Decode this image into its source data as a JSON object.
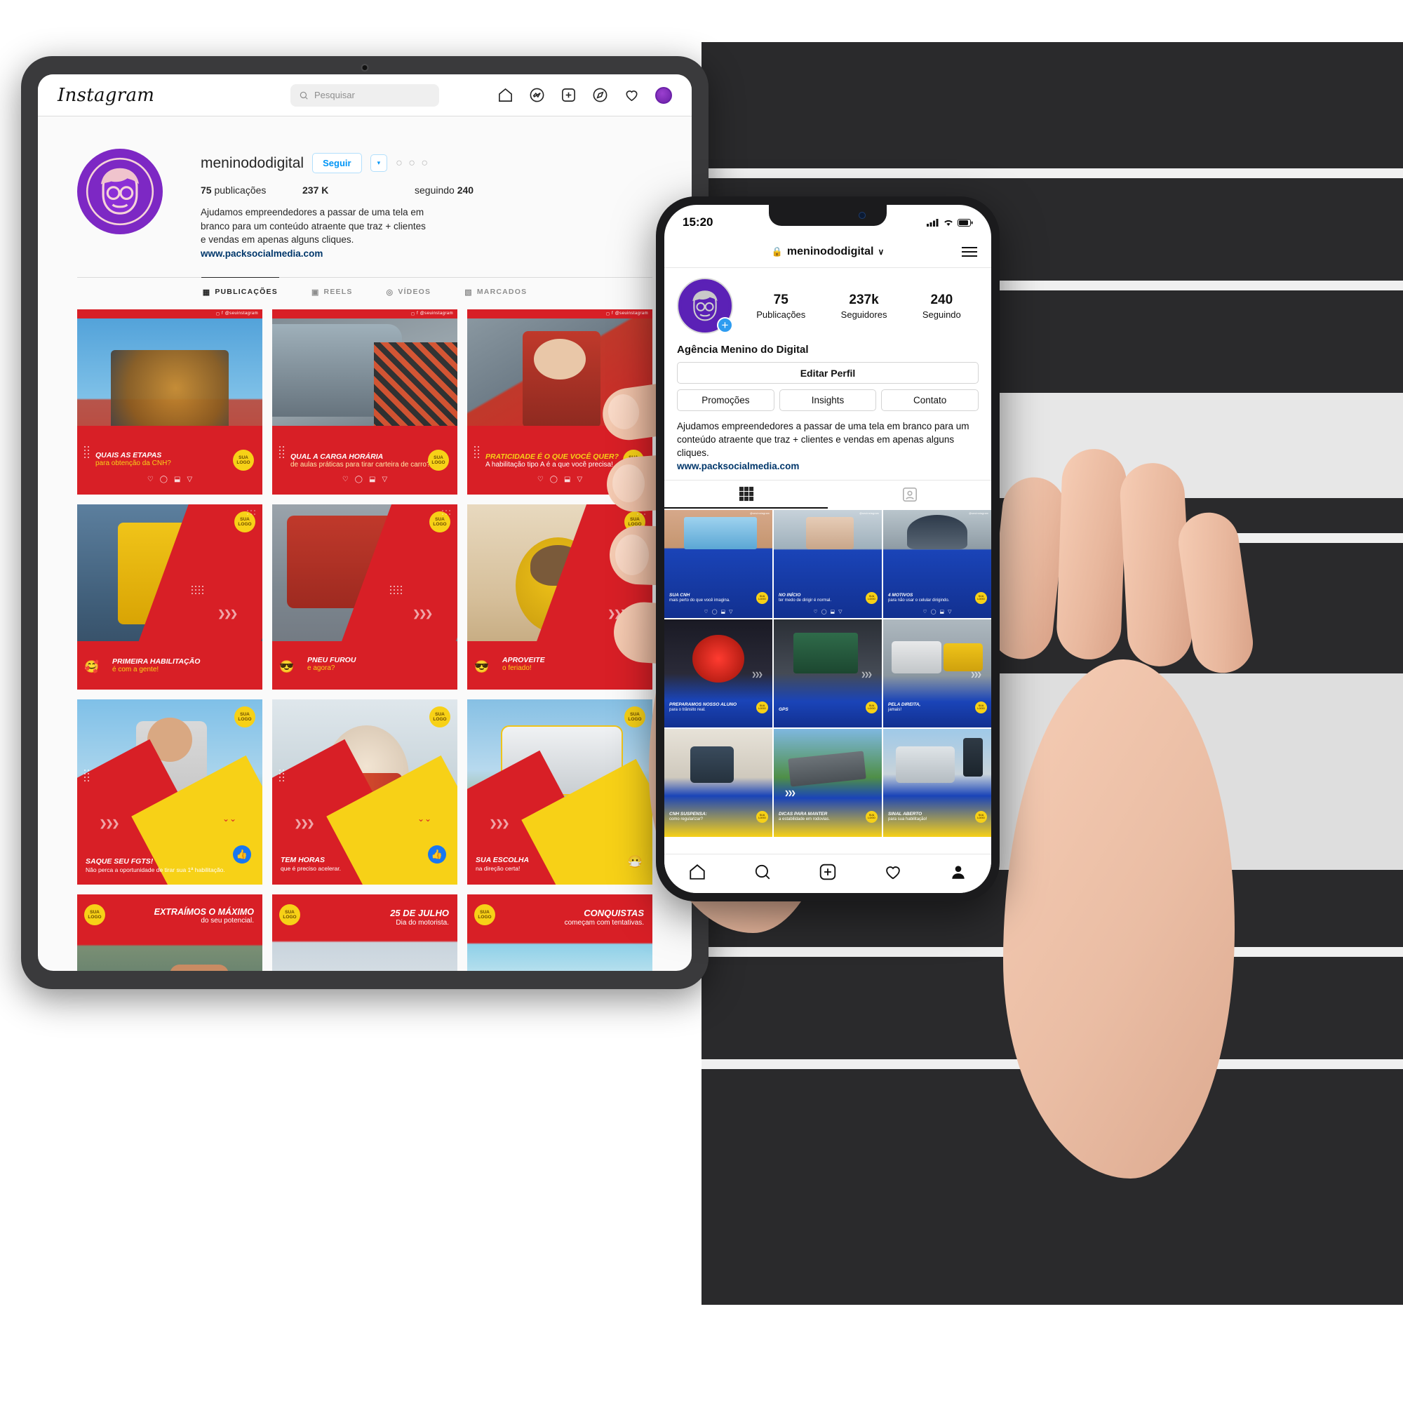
{
  "tablet": {
    "header": {
      "logo": "Instagram",
      "search_placeholder": "Pesquisar",
      "nav_icons": [
        "home-icon",
        "messenger-icon",
        "new-post-icon",
        "explore-icon",
        "activity-icon",
        "profile-avatar-icon"
      ]
    },
    "profile": {
      "username": "meninododigital",
      "follow_label": "Seguir",
      "caret_label": "▾",
      "more_label": "○ ○ ○",
      "stats": {
        "posts_value": "75",
        "posts_label": "publicações",
        "followers_value": "237 K",
        "following_label": "seguindo",
        "following_value": "240"
      },
      "bio": "Ajudamos empreendedores a passar de uma tela em branco para um conteúdo atraente que traz + clientes e vendas em apenas alguns cliques.",
      "link": "www.packsocialmedia.com"
    },
    "tabs": [
      {
        "label": "PUBLICAÇÕES",
        "icon": "grid-icon",
        "active": true
      },
      {
        "label": "REELS",
        "icon": "reels-icon",
        "active": false
      },
      {
        "label": "VÍDEOS",
        "icon": "video-icon",
        "active": false
      },
      {
        "label": "MARCADOS",
        "icon": "tagged-icon",
        "active": false
      }
    ],
    "watermark": "@seuinstagram",
    "sua_logo_line1": "SUA",
    "sua_logo_line2": "LOGO",
    "posts": [
      {
        "title": "QUAIS AS ETAPAS",
        "sub": "para obtenção da CNH?",
        "theme": "red",
        "layout": "bar-bottom"
      },
      {
        "title": "QUAL A CARGA HORÁRIA",
        "sub": "de aulas práticas para tirar carteira de carro?",
        "theme": "red",
        "layout": "bar-bottom"
      },
      {
        "title": "PRATICIDADE É O QUE VOCÊ QUER?",
        "sub": "A habilitação tipo A é a que você precisa!",
        "theme": "red",
        "layout": "bar-bottom"
      },
      {
        "title": "PRIMEIRA HABILITAÇÃO",
        "sub": "é com a gente!",
        "theme": "red-diag",
        "layout": "emoji",
        "emoji": "🥰"
      },
      {
        "title": "PNEU FUROU",
        "sub": "e agora?",
        "theme": "red-diag",
        "layout": "emoji",
        "emoji": "😎"
      },
      {
        "title": "APROVEITE",
        "sub": "o feriado!",
        "theme": "red-diag",
        "layout": "emoji",
        "emoji": "😎"
      },
      {
        "title": "SAQUE SEU FGTS!",
        "sub": "Não perca a oportunidade de tirar sua 1ª habilitação.",
        "theme": "yellow-red",
        "layout": "thumb"
      },
      {
        "title": "TEM HORAS",
        "sub": "que é preciso acelerar.",
        "theme": "yellow-red",
        "layout": "thumb"
      },
      {
        "title": "SUA ESCOLHA",
        "sub": "na direção certa!",
        "theme": "yellow-red",
        "layout": "thumb-emoji",
        "emoji": "😷"
      },
      {
        "title": "EXTRAÍMOS O MÁXIMO",
        "sub": "do seu potencial.",
        "theme": "red-top",
        "layout": "bar-top"
      },
      {
        "title": "25 DE JULHO",
        "sub": "Dia do motorista.",
        "theme": "red-top",
        "layout": "bar-top"
      },
      {
        "title": "CONQUISTAS",
        "sub": "começam com tentativas.",
        "theme": "red-top",
        "layout": "bar-top"
      }
    ]
  },
  "phone": {
    "status": {
      "time": "15:20",
      "signal_icon": "cellular-icon",
      "wifi_icon": "wifi-icon",
      "battery_icon": "battery-icon"
    },
    "header": {
      "lock_icon": "lock-icon",
      "username": "meninododigital",
      "chevron": "∨",
      "menu_icon": "hamburger-icon"
    },
    "profile": {
      "stats": [
        {
          "value": "75",
          "label": "Publicações"
        },
        {
          "value": "237k",
          "label": "Seguidores"
        },
        {
          "value": "240",
          "label": "Seguindo"
        }
      ],
      "display_name": "Agência Menino do Digital",
      "edit_label": "Editar Perfil",
      "actions": [
        "Promoções",
        "Insights",
        "Contato"
      ],
      "bio": "Ajudamos empreendedores a passar de uma tela em branco para um conteúdo atraente que traz + clientes e vendas em apenas alguns cliques.",
      "link": "www.packsocialmedia.com",
      "add_story_icon": "plus-icon"
    },
    "tabs": [
      {
        "icon": "grid-icon",
        "active": true
      },
      {
        "icon": "tagged-icon",
        "active": false
      }
    ],
    "watermark": "@seuinstagram",
    "sua_logo_line1": "SUA",
    "sua_logo_line2": "LOGO",
    "posts": [
      {
        "title": "SUA CNH",
        "sub": "mais perto do que você imagina.",
        "theme": "blue"
      },
      {
        "title": "NO INÍCIO",
        "sub": "ter medo de dirigir é normal.",
        "theme": "blue"
      },
      {
        "title": "4 MOTIVOS",
        "sub": "para não usar o celular dirigindo.",
        "theme": "blue"
      },
      {
        "title": "PREPARAMOS NOSSO ALUNO",
        "sub": "para o trânsito real.",
        "theme": "blue"
      },
      {
        "title": "GPS",
        "sub": "",
        "theme": "blue"
      },
      {
        "title": "PELA DIREITA,",
        "sub": "jamais!",
        "theme": "blue"
      },
      {
        "title": "CNH SUSPENSA:",
        "sub": "como regularizar?",
        "theme": "blue-yellow"
      },
      {
        "title": "DICAS PARA MANTER",
        "sub": "a estabilidade em rodovias.",
        "theme": "blue-yellow"
      },
      {
        "title": "SINAL ABERTO",
        "sub": "para sua habilitação!",
        "theme": "blue-yellow"
      }
    ],
    "nav_icons": [
      "home-icon",
      "search-icon",
      "add-post-icon",
      "heart-icon",
      "profile-icon"
    ]
  },
  "colors": {
    "brand_purple": "#7d28c4",
    "ig_blue": "#0095f6",
    "post_red": "#d81f26",
    "post_yellow": "#f7d117",
    "post_blue": "#1a44b8"
  }
}
